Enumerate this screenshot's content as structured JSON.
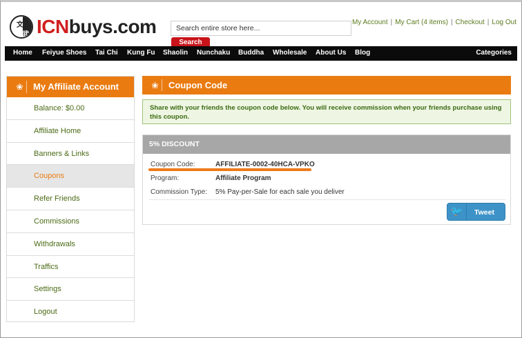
{
  "header": {
    "logo_prefix": "ICN",
    "logo_suffix": "buys.com",
    "logo_glyph_top": "文",
    "logo_glyph_bottom": "武",
    "search_placeholder": "Search entire store here...",
    "search_button": "Search",
    "toplinks": [
      "My Account",
      "My Cart (4 items)",
      "Checkout",
      "Log Out"
    ]
  },
  "nav": {
    "items": [
      "Home",
      "Feiyue Shoes",
      "Tai Chi",
      "Kung Fu",
      "Shaolin",
      "Nunchaku",
      "Buddha",
      "Wholesale",
      "About Us",
      "Blog"
    ],
    "categories": "Categories"
  },
  "sidebar": {
    "title": "My Affiliate Account",
    "items": [
      "Balance: $0.00",
      "Affiliate Home",
      "Banners & Links",
      "Coupons",
      "Refer Friends",
      "Commissions",
      "Withdrawals",
      "Traffics",
      "Settings",
      "Logout"
    ],
    "active": "Coupons"
  },
  "main": {
    "title": "Coupon Code",
    "notice": "Share with your friends the coupon code below. You will receive commission when your friends purchase using this coupon.",
    "coupon": {
      "heading": "5% DISCOUNT",
      "code_label": "Coupon Code:",
      "code_value": "AFFILIATE-0002-40HCA-VPKO",
      "program_label": "Program:",
      "program_value": "Affiliate Program",
      "commission_label": "Commission Type:",
      "commission_value": "5% Pay-per-Sale for each sale you deliver"
    },
    "tweet_label": "Tweet"
  },
  "colors": {
    "accent_orange": "#ea7b11",
    "brand_red": "#d01f1f",
    "link_green": "#5b7a1e",
    "nav_black": "#0b0b0b",
    "tweet_blue": "#3d93c8"
  }
}
